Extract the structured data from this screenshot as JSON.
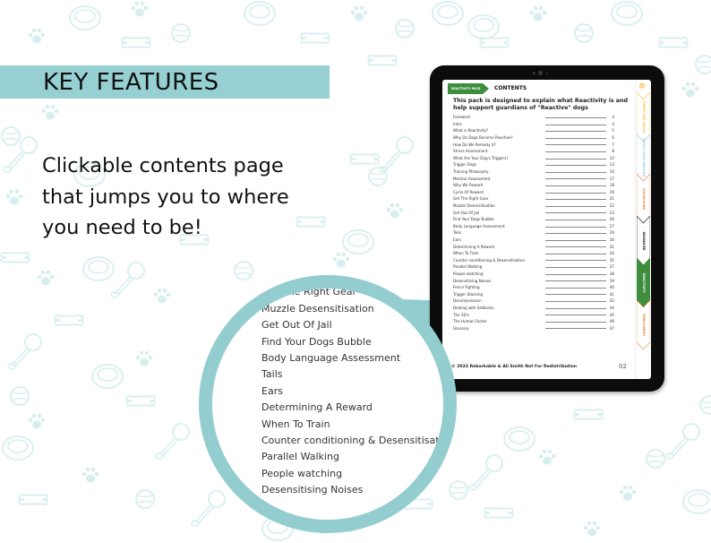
{
  "heading": "KEY FEATURES",
  "description": "Clickable contents page that jumps you to where you need to be!",
  "colors": {
    "teal": "#96d0d2",
    "green": "#3e8e3e",
    "pattern": "#d7eeef"
  },
  "tablet": {
    "pack_tag": "REACTIVITY PACK",
    "contents_title": "CONTENTS",
    "intro": "This pack is designed to explain what Reactivity is and help support guardians of \"Reactive\" dogs",
    "toc": [
      {
        "title": "Foreword",
        "page": "3"
      },
      {
        "title": "Intro",
        "page": "4"
      },
      {
        "title": "What is Reactivity?",
        "page": "5"
      },
      {
        "title": "Why Do Dogs Become Reactive?",
        "page": "6"
      },
      {
        "title": "How Do We Remedy it?",
        "page": "7"
      },
      {
        "title": "Stress Assessment",
        "page": "8"
      },
      {
        "title": "What Are Your Dog's Triggers?",
        "page": "12"
      },
      {
        "title": "Trigger Dogs",
        "page": "13"
      },
      {
        "title": "Training Philosophy",
        "page": "16"
      },
      {
        "title": "Medical Assessment",
        "page": "17"
      },
      {
        "title": "Why We Reward",
        "page": "18"
      },
      {
        "title": "Cycle Of Reward",
        "page": "19"
      },
      {
        "title": "Get The Right Gear",
        "page": "21"
      },
      {
        "title": "Muzzle Desensitisation",
        "page": "22"
      },
      {
        "title": "Get Out Of Jail",
        "page": "23"
      },
      {
        "title": "Find Your Dogs Bubble",
        "page": "26"
      },
      {
        "title": "Body Language Assessment",
        "page": "27"
      },
      {
        "title": "Tails",
        "page": "29"
      },
      {
        "title": "Ears",
        "page": "30"
      },
      {
        "title": "Determining A Reward",
        "page": "31"
      },
      {
        "title": "When To Train",
        "page": "34"
      },
      {
        "title": "Counter conditioning & Desensitisation",
        "page": "35"
      },
      {
        "title": "Parallel Walking",
        "page": "37"
      },
      {
        "title": "People watching",
        "page": "38"
      },
      {
        "title": "Desensitising Noises",
        "page": "39"
      },
      {
        "title": "Fence Fighting",
        "page": "40"
      },
      {
        "title": "Trigger Stacking",
        "page": "41"
      },
      {
        "title": "Decompression",
        "page": "42"
      },
      {
        "title": "Dealing with Setbacks",
        "page": "44"
      },
      {
        "title": "The 3D's",
        "page": "45"
      },
      {
        "title": "The Human Factor",
        "page": "46"
      },
      {
        "title": "Glossary",
        "page": "47"
      }
    ],
    "footer": "© 2023 Rebarkable & Ali Smith  Not For Redistribution",
    "page_number": "02",
    "side_tabs": [
      {
        "label": "PUPPY LIFE SKILLS",
        "color": "#f3c24a",
        "active": false
      },
      {
        "label": "LOOSE LEAD WALKING",
        "color": "#9ccfe0",
        "active": false
      },
      {
        "label": "SOCIALISING",
        "color": "#e58a4f",
        "active": false
      },
      {
        "label": "ADVANCED",
        "color": "#222222",
        "active": false
      },
      {
        "label": "REACTIVITY",
        "color": "#3e8e3e",
        "active": true
      },
      {
        "label": "ENRICHMENT",
        "color": "#e58a4f",
        "active": false
      }
    ]
  },
  "magnified_list": [
    "Cycle Of Reward",
    "Get The Right Gear",
    "Muzzle Desensitisation",
    "Get Out Of Jail",
    "Find Your Dogs Bubble",
    "Body Language Assessment",
    "Tails",
    "Ears",
    "Determining A Reward",
    "When To Train",
    "Counter conditioning & Desensitisation",
    "Parallel Walking",
    "People watching",
    "Desensitising Noises"
  ]
}
